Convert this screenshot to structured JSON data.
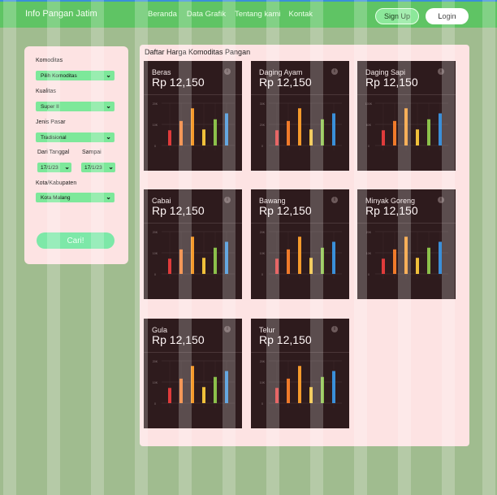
{
  "header": {
    "brand": "Info Pangan Jatim",
    "nav": [
      "Beranda",
      "Data Grafik",
      "Tentang kami",
      "Kontak"
    ],
    "signup_label": "Sign Up",
    "login_label": "Login"
  },
  "filters": {
    "komoditas_label": "Komoditas",
    "komoditas_value": "Pilih Komoditas",
    "kualitas_label": "Kualitas",
    "kualitas_value": "Super II",
    "jenis_pasar_label": "Jenis Pasar",
    "jenis_pasar_value": "Tradisional",
    "dari_tanggal_label": "Dari Tanggal",
    "dari_tanggal_value": "17/1/23",
    "sampai_label": "Sampai",
    "sampai_value": "17/1/23",
    "kota_label": "Kota/Kabupaten",
    "kota_value": "Kota Malang",
    "search_label": "Cari!"
  },
  "main": {
    "title": "Daftar Harga Komoditas Pangan",
    "cards": [
      {
        "name": "Beras",
        "price": "Rp 12,150",
        "yticks": [
          "20K",
          "10K",
          "0"
        ]
      },
      {
        "name": "Daging Ayam",
        "price": "Rp 12,150",
        "yticks": [
          "30K",
          "20K",
          "0"
        ]
      },
      {
        "name": "Daging Sapi",
        "price": "Rp 12,150",
        "yticks": [
          "100K",
          "60K",
          "0"
        ]
      },
      {
        "name": "Cabai",
        "price": "Rp 12,150",
        "yticks": [
          "20K",
          "10K",
          "0"
        ]
      },
      {
        "name": "Bawang",
        "price": "Rp 12,150",
        "yticks": [
          "20K",
          "10K",
          "0"
        ]
      },
      {
        "name": "Minyak Goreng",
        "price": "Rp 12,150",
        "yticks": [
          "20K",
          "10K",
          "0"
        ]
      },
      {
        "name": "Gula",
        "price": "Rp 12,150",
        "yticks": [
          "20K",
          "10K",
          "0"
        ]
      },
      {
        "name": "Telur",
        "price": "Rp 12,150",
        "yticks": [
          "20K",
          "10K",
          "0"
        ]
      }
    ],
    "bar_colors": [
      "#e03b3b",
      "#f07a2a",
      "#f59a2b",
      "#f0c03a",
      "#8bc04a",
      "#3a8fd9"
    ],
    "bar_values": [
      0.36,
      0.58,
      0.88,
      0.38,
      0.62,
      0.76
    ]
  }
}
